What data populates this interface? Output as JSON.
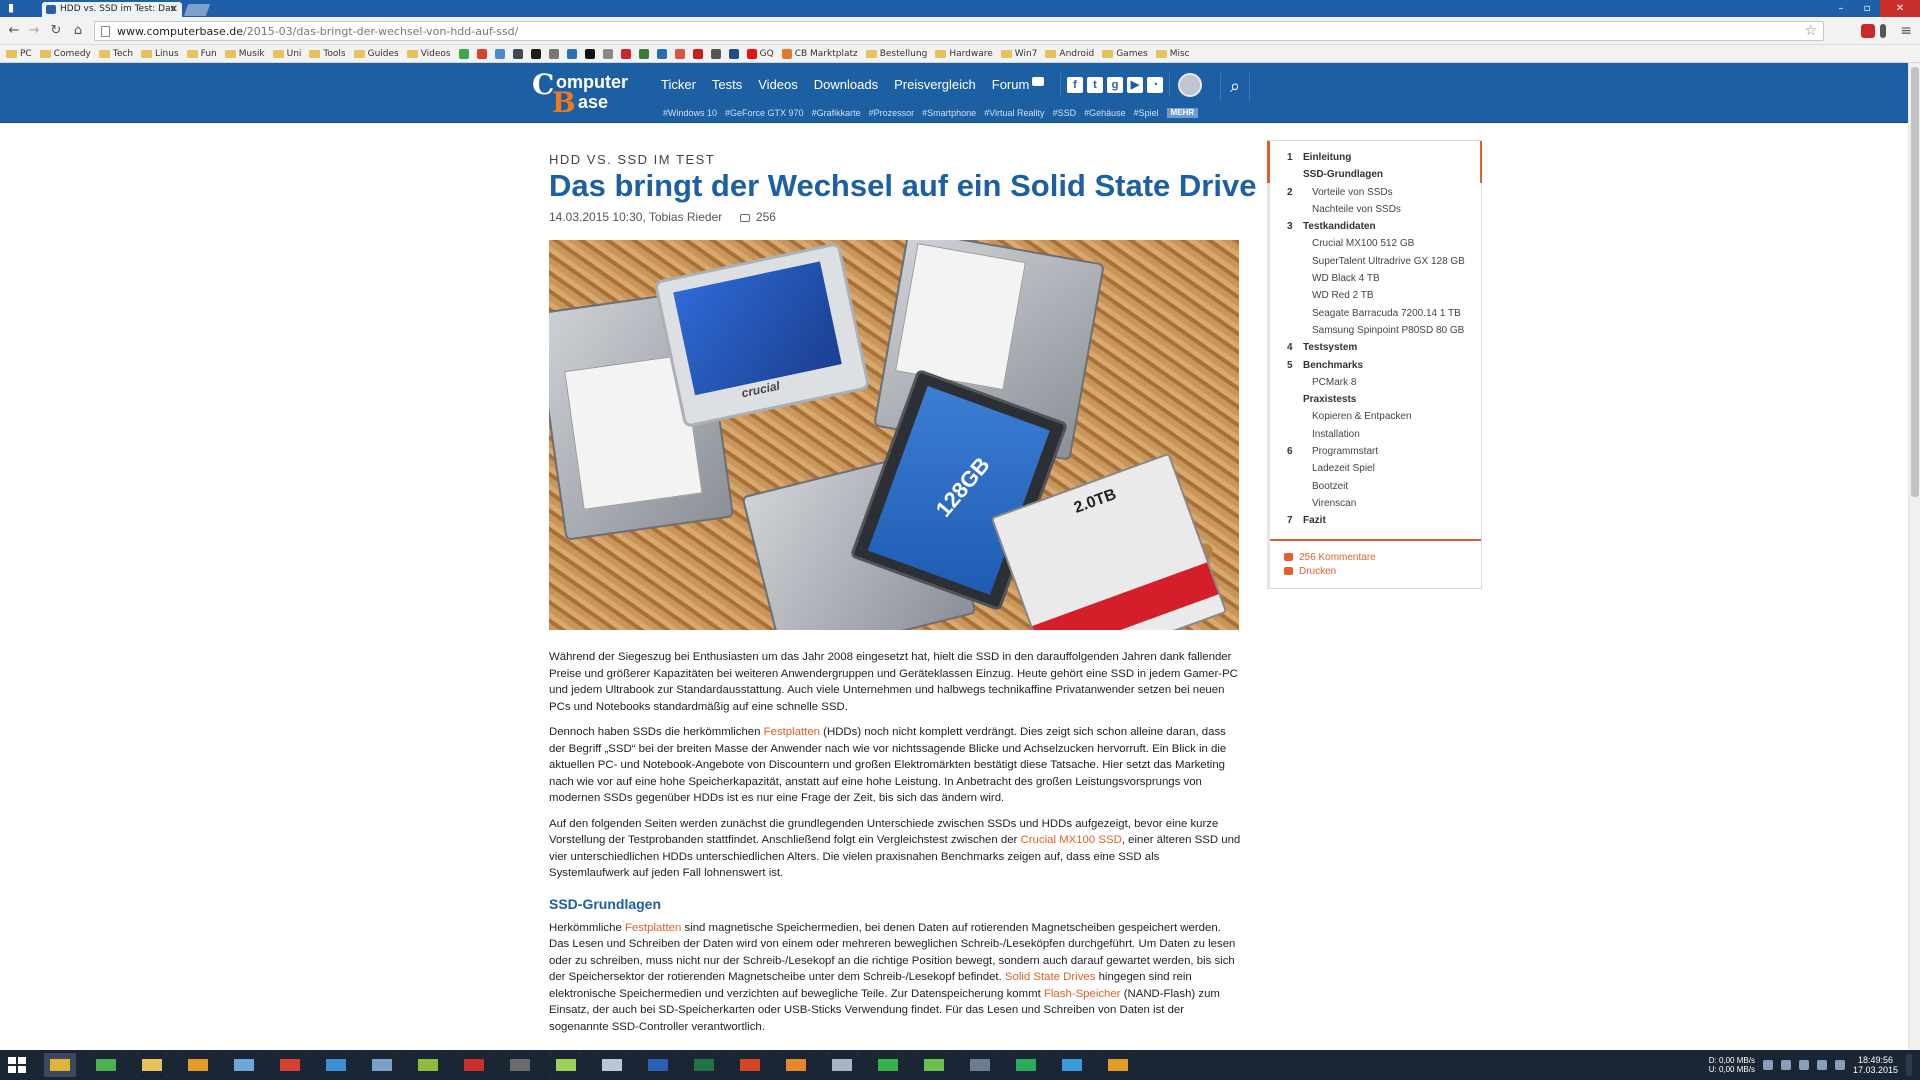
{
  "browser": {
    "tab_title": "HDD vs. SSD im Test: Das",
    "url_host": "www.computerbase.de",
    "url_path": "/2015-03/das-bringt-der-wechsel-von-hdd-auf-ssd/",
    "bookmarks": [
      "PC",
      "Comedy",
      "Tech",
      "Linus",
      "Fun",
      "Musik",
      "Uni",
      "Tools",
      "Guides",
      "Videos",
      "GQ",
      "CB Marktplatz",
      "Bestellung",
      "Hardware",
      "Win7",
      "Android",
      "Games",
      "Misc"
    ]
  },
  "site": {
    "logo_c": "C",
    "logo_omputer": "omputer",
    "logo_b": "B",
    "logo_ase": "ase",
    "nav": [
      "Ticker",
      "Tests",
      "Videos",
      "Downloads",
      "Preisvergleich",
      "Forum"
    ],
    "tags": [
      "#Windows 10",
      "#GeForce GTX 970",
      "#Grafikkarte",
      "#Prozessor",
      "#Smartphone",
      "#Virtual Reality",
      "#SSD",
      "#Gehäuse",
      "#Spiel"
    ],
    "tags_more": "MEHR"
  },
  "article": {
    "kicker": "HDD VS. SSD IM TEST",
    "title": "Das bringt der Wechsel auf ein Solid State Drive",
    "meta": "14.03.2015 10:30, Tobias Rieder",
    "comment_count": "256",
    "image_texts": {
      "crucial": "crucial",
      "st_capacity": "128GB",
      "wd_capacity": "2.0TB"
    },
    "p1": "Während der Siegeszug bei Enthusiasten um das Jahr 2008 eingesetzt hat, hielt die SSD in den darauffolgenden Jahren dank fallender Preise und größerer Kapazitäten bei weiteren Anwendergruppen und Geräteklassen Einzug. Heute gehört eine SSD in jedem Gamer-PC und jedem Ultrabook zur Standardausstattung. Auch viele Unternehmen und halbwegs technikaffine Privatanwender setzen bei neuen PCs und Notebooks standardmäßig auf eine schnelle SSD.",
    "p2_pre": "Dennoch haben SSDs die herkömmlichen ",
    "p2_link": "Festplatten",
    "p2_post": " (HDDs) noch nicht komplett verdrängt. Dies zeigt sich schon alleine daran, dass der Begriff „SSD“ bei der breiten Masse der Anwender nach wie vor nichtssagende Blicke und Achselzucken hervorruft. Ein Blick in die aktuellen PC- und Notebook-Angebote von Discountern und großen Elektromärkten bestätigt diese Tatsache. Hier setzt das Marketing nach wie vor auf eine hohe Speicherkapazität, anstatt auf eine hohe Leistung. In Anbetracht des großen Leistungsvorsprungs von modernen SSDs gegenüber HDDs ist es nur eine Frage der Zeit, bis sich das ändern wird.",
    "p3_pre": "Auf den folgenden Seiten werden zunächst die grundlegenden Unterschiede zwischen SSDs und HDDs aufgezeigt, bevor eine kurze Vorstellung der Testprobanden stattfindet. Anschließend folgt ein Vergleichstest zwischen der ",
    "p3_link": "Crucial MX100 SSD",
    "p3_post": ", einer älteren SSD und vier unterschiedlichen HDDs unterschiedlichen Alters. Die vielen praxisnahen Benchmarks zeigen auf, dass eine SSD als Systemlaufwerk auf jeden Fall lohnenswert ist.",
    "h2": "SSD-Grundlagen",
    "p4_a": "Herkömmliche ",
    "p4_link1": "Festplatten",
    "p4_b": " sind magnetische Speichermedien, bei denen Daten auf rotierenden Magnetscheiben gespeichert werden. Das Lesen und Schreiben der Daten wird von einem oder mehreren beweglichen Schreib-/Leseköpfen durchgeführt. Um Daten zu lesen oder zu schreiben, muss nicht nur der Schreib-/Lesekopf an die richtige Position bewegt, sondern auch darauf gewartet werden, bis sich der Speichersektor der rotierenden Magnetscheibe unter dem Schreib-/Lesekopf befindet. ",
    "p4_link2": "Solid State Drives",
    "p4_c": " hingegen sind rein elektronische Speichermedien und verzichten auf bewegliche Teile. Zur Datenspeicherung kommt ",
    "p4_link3": "Flash-Speicher",
    "p4_d": " (NAND-Flash) zum Einsatz, der auch bei SD-Speicherkarten oder USB-Sticks Verwendung findet. Für das Lesen und Schreiben von Daten ist der sogenannte SSD-Controller verantwortlich."
  },
  "toc": {
    "items": [
      {
        "num": "1",
        "label": "Einleitung",
        "level": "top"
      },
      {
        "num": "",
        "label": "SSD-Grundlagen",
        "level": "top"
      },
      {
        "num": "2",
        "label": "Vorteile von SSDs",
        "level": "sub"
      },
      {
        "num": "",
        "label": "Nachteile von SSDs",
        "level": "sub"
      },
      {
        "num": "3",
        "label": "Testkandidaten",
        "level": "top"
      },
      {
        "num": "",
        "label": "Crucial MX100 512 GB",
        "level": "sub"
      },
      {
        "num": "",
        "label": "SuperTalent Ultradrive GX 128 GB",
        "level": "sub"
      },
      {
        "num": "",
        "label": "WD Black 4 TB",
        "level": "sub"
      },
      {
        "num": "",
        "label": "WD Red 2 TB",
        "level": "sub"
      },
      {
        "num": "",
        "label": "Seagate Barracuda 7200.14 1 TB",
        "level": "sub"
      },
      {
        "num": "",
        "label": "Samsung Spinpoint P80SD 80 GB",
        "level": "sub"
      },
      {
        "num": "4",
        "label": "Testsystem",
        "level": "top"
      },
      {
        "num": "5",
        "label": "Benchmarks",
        "level": "top"
      },
      {
        "num": "",
        "label": "PCMark 8",
        "level": "sub"
      },
      {
        "num": "",
        "label": "Praxistests",
        "level": "top"
      },
      {
        "num": "",
        "label": "Kopieren & Entpacken",
        "level": "sub"
      },
      {
        "num": "",
        "label": "Installation",
        "level": "sub"
      },
      {
        "num": "6",
        "label": "Programmstart",
        "level": "sub"
      },
      {
        "num": "",
        "label": "Ladezeit Spiel",
        "level": "sub"
      },
      {
        "num": "",
        "label": "Bootzeit",
        "level": "sub"
      },
      {
        "num": "",
        "label": "Virenscan",
        "level": "sub"
      },
      {
        "num": "7",
        "label": "Fazit",
        "level": "top"
      }
    ],
    "comments_link": "256 Kommentare",
    "print_link": "Drucken"
  },
  "taskbar": {
    "net_down": "0,00 MB/s",
    "net_up": "0,00 MB/s",
    "net_d_label": "D:",
    "net_u_label": "U:",
    "time": "18:49:56",
    "date": "17.03.2015"
  },
  "colors": {
    "brand": "#1c5fa3",
    "accent": "#e0602a"
  }
}
